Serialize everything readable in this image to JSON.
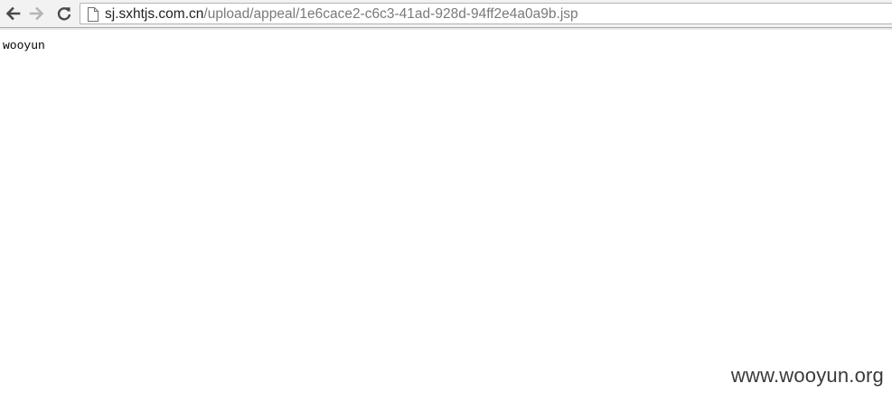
{
  "browser": {
    "url_host": "sj.sxhtjs.com.cn",
    "url_path": "/upload/appeal/1e6cace2-c6c3-41ad-928d-94ff2e4a0a9b.jsp",
    "icons": {
      "back": "back-arrow-icon",
      "forward": "forward-arrow-icon",
      "reload": "reload-icon",
      "page": "page-icon"
    }
  },
  "page": {
    "body_text": "wooyun"
  },
  "watermark": {
    "text": "www.wooyun.org"
  }
}
